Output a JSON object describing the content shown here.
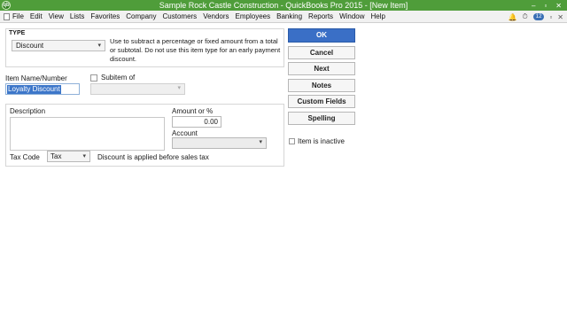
{
  "window": {
    "title": "Sample Rock Castle Construction  - QuickBooks Pro 2015 - [New Item]",
    "controls": [
      "–",
      "▫",
      "✕"
    ]
  },
  "menu": {
    "items": [
      "File",
      "Edit",
      "View",
      "Lists",
      "Favorites",
      "Company",
      "Customers",
      "Vendors",
      "Employees",
      "Banking",
      "Reports",
      "Window",
      "Help"
    ],
    "notification_count": "12"
  },
  "form": {
    "type_label": "TYPE",
    "type_value": "Discount",
    "type_description": "Use to subtract a percentage or fixed amount from a total or subtotal. Do not use this item type for an early payment discount.",
    "item_name_label": "Item Name/Number",
    "item_name_value": "Loyalty Discount",
    "subitem_label": "Subitem of",
    "subitem_value": "",
    "description_label": "Description",
    "description_value": "",
    "amount_label": "Amount or %",
    "amount_value": "0.00",
    "account_label": "Account",
    "account_value": "",
    "tax_code_label": "Tax Code",
    "tax_code_value": "Tax",
    "tax_note": "Discount is applied before sales tax"
  },
  "buttons": {
    "ok": "OK",
    "cancel": "Cancel",
    "next": "Next",
    "notes": "Notes",
    "custom_fields": "Custom Fields",
    "spelling": "Spelling"
  },
  "inactive_label": "Item is inactive",
  "colors": {
    "titlebar": "#4f9d3a",
    "ok_button": "#3a6fc6",
    "selection": "#3c76c9"
  }
}
